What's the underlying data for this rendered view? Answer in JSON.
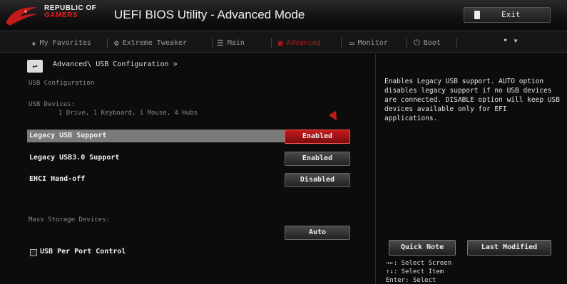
{
  "header": {
    "brand_line1": "REPUBLIC OF",
    "brand_line2": "GAMERS",
    "title": "UEFI BIOS Utility - Advanced Mode",
    "exit_label": "Exit"
  },
  "tabs": [
    {
      "label": "My Favorites",
      "icon": "star-icon"
    },
    {
      "label": "Extreme Tweaker",
      "icon": "tweaker-icon"
    },
    {
      "label": "Main",
      "icon": "list-icon"
    },
    {
      "label": "Advanced",
      "icon": "advanced-icon",
      "active": true
    },
    {
      "label": "Monitor",
      "icon": "monitor-icon"
    },
    {
      "label": "Boot",
      "icon": "power-icon"
    }
  ],
  "breadcrumb": "Advanced\\ USB Configuration >",
  "usb_configuration_header": "USB Configuration",
  "usb_devices": {
    "label": "USB Devices:",
    "value": "1 Drive, 1 Keyboard, 1 Mouse, 4 Hubs"
  },
  "settings": [
    {
      "label": "Legacy USB Support",
      "value": "Enabled",
      "selected": true
    },
    {
      "label": "Legacy USB3.0 Support",
      "value": "Enabled"
    },
    {
      "label": "EHCI Hand-off",
      "value": "Disabled"
    }
  ],
  "mass_storage": {
    "label": "Mass Storage Devices:",
    "value": "Auto"
  },
  "usb_per_port": "USB Per Port Control",
  "help": {
    "text": "Enables Legacy USB support. AUTO option disables legacy support if no USB devices are connected. DISABLE option will keep USB devices available only for EFI applications.",
    "quick_note": "Quick Note",
    "last_modified": "Last Modified",
    "keys": [
      "→←: Select Screen",
      "↑↓: Select Item",
      "Enter: Select"
    ]
  },
  "colors": {
    "accent": "#c41a1a",
    "background": "#0c0c0c"
  }
}
